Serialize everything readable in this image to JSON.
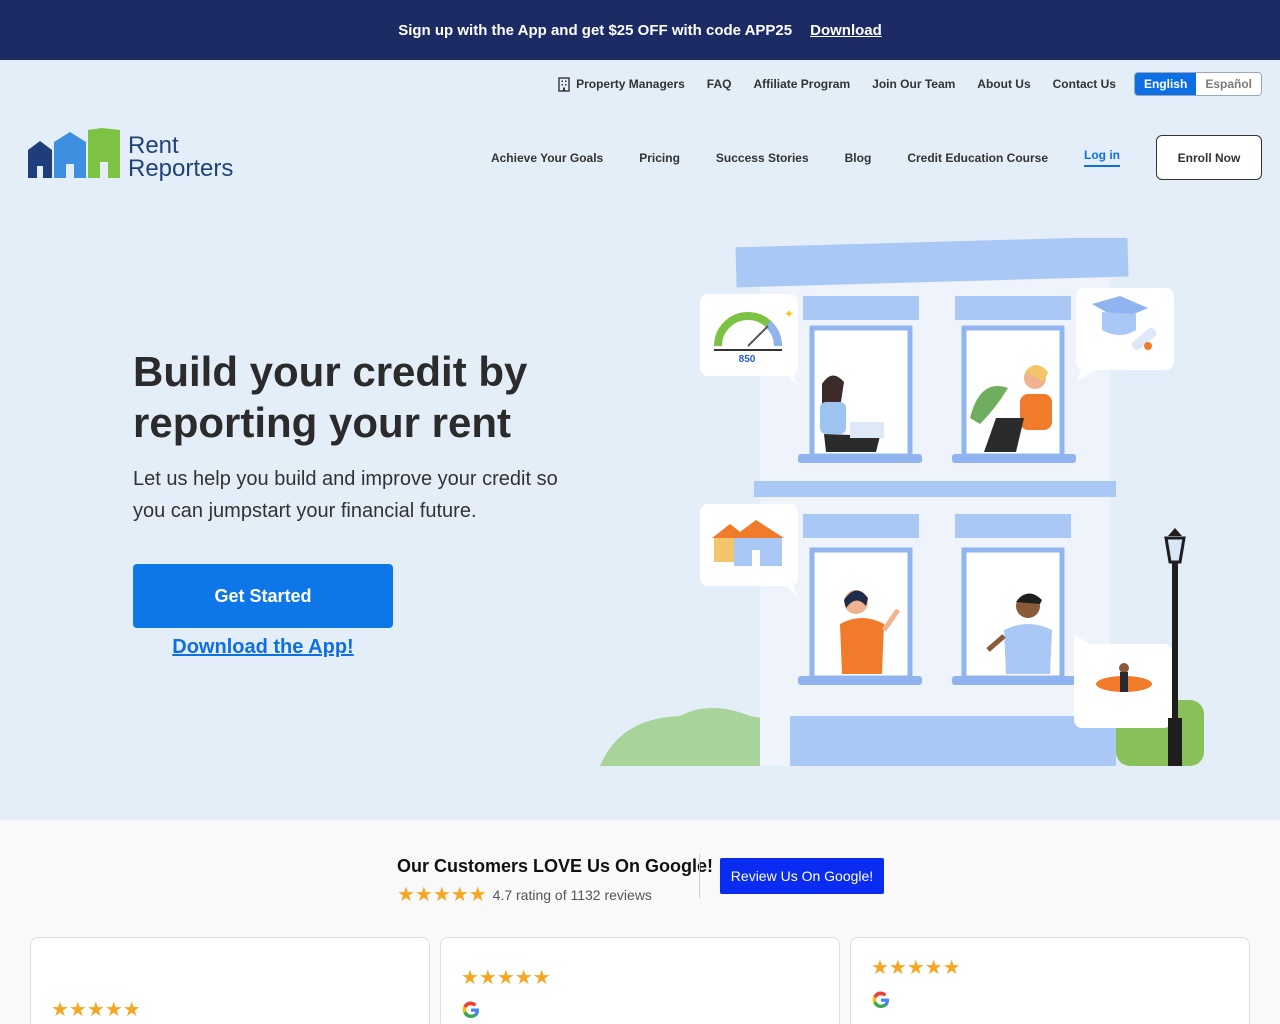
{
  "promo": {
    "text": "Sign up with the App and get $25 OFF with code APP25",
    "link": "Download"
  },
  "util_nav": {
    "property_managers": "Property Managers",
    "faq": "FAQ",
    "affiliate": "Affiliate Program",
    "join": "Join Our Team",
    "about": "About Us",
    "contact": "Contact Us",
    "lang_en": "English",
    "lang_es": "Español"
  },
  "brand": {
    "line1": "Rent",
    "line2": "Reporters"
  },
  "main_nav": {
    "goals": "Achieve Your Goals",
    "pricing": "Pricing",
    "stories": "Success Stories",
    "blog": "Blog",
    "course": "Credit Education Course",
    "login": "Log in",
    "enroll": "Enroll Now"
  },
  "hero": {
    "title": "Build your credit by reporting your rent",
    "subtitle": "Let us help you build and improve your credit so you can jumpstart your financial future.",
    "cta": "Get Started",
    "download": "Download the App!",
    "score": "850"
  },
  "reviews": {
    "title": "Our Customers LOVE Us On Google!",
    "rating_text": "4.7 rating of 1132 reviews",
    "rating_value": 4.7,
    "button": "Review Us On Google!",
    "stars_char": "★★★★★"
  },
  "colors": {
    "brand_blue": "#0d77e8",
    "navy": "#1c2b63",
    "star": "#f5a623",
    "google_btn": "#0a2bf0"
  }
}
